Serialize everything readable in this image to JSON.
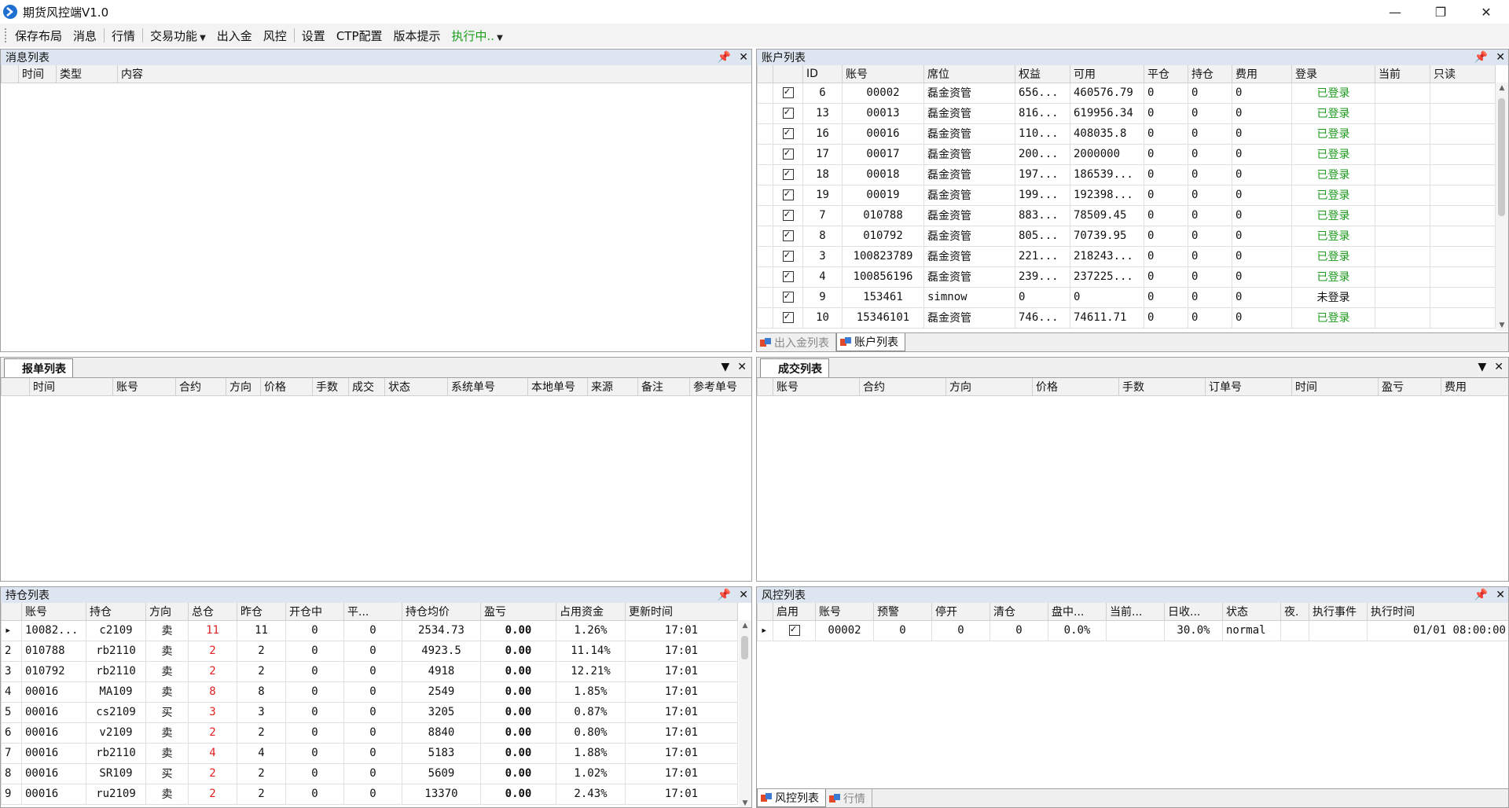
{
  "window": {
    "title": "期货风控端V1.0",
    "minimize": "—",
    "restore": "❐",
    "close": "✕"
  },
  "menu": {
    "items": [
      "保存布局",
      "消息",
      "行情",
      "交易功能",
      "出入金",
      "风控",
      "设置",
      "CTP配置",
      "版本提示",
      "执行中.."
    ]
  },
  "panels": {
    "messages": {
      "title": "消息列表",
      "columns": [
        "时间",
        "类型",
        "内容"
      ]
    },
    "accounts": {
      "title": "账户列表",
      "columns": [
        "",
        "ID",
        "账号",
        "席位",
        "权益",
        "可用",
        "平仓",
        "持仓",
        "费用",
        "登录",
        "当前",
        "只读"
      ],
      "rows": [
        [
          "6",
          "00002",
          "磊金资管",
          "656...",
          "460576.79",
          "0",
          "0",
          "0",
          "已登录"
        ],
        [
          "13",
          "00013",
          "磊金资管",
          "816...",
          "619956.34",
          "0",
          "0",
          "0",
          "已登录"
        ],
        [
          "16",
          "00016",
          "磊金资管",
          "110...",
          "408035.8",
          "0",
          "0",
          "0",
          "已登录"
        ],
        [
          "17",
          "00017",
          "磊金资管",
          "200...",
          "2000000",
          "0",
          "0",
          "0",
          "已登录"
        ],
        [
          "18",
          "00018",
          "磊金资管",
          "197...",
          "186539...",
          "0",
          "0",
          "0",
          "已登录"
        ],
        [
          "19",
          "00019",
          "磊金资管",
          "199...",
          "192398...",
          "0",
          "0",
          "0",
          "已登录"
        ],
        [
          "7",
          "010788",
          "磊金资管",
          "883...",
          "78509.45",
          "0",
          "0",
          "0",
          "已登录"
        ],
        [
          "8",
          "010792",
          "磊金资管",
          "805...",
          "70739.95",
          "0",
          "0",
          "0",
          "已登录"
        ],
        [
          "3",
          "100823789",
          "磊金资管",
          "221...",
          "218243...",
          "0",
          "0",
          "0",
          "已登录"
        ],
        [
          "4",
          "100856196",
          "磊金资管",
          "239...",
          "237225...",
          "0",
          "0",
          "0",
          "已登录"
        ],
        [
          "9",
          "153461",
          "simnow",
          "0",
          "0",
          "0",
          "0",
          "0",
          "未登录"
        ],
        [
          "10",
          "15346101",
          "磊金资管",
          "746...",
          "74611.71",
          "0",
          "0",
          "0",
          "已登录"
        ]
      ],
      "tabs": [
        "出入金列表",
        "账户列表"
      ]
    },
    "orders": {
      "tab": "报单列表",
      "columns": [
        "时间",
        "账号",
        "合约",
        "方向",
        "价格",
        "手数",
        "成交",
        "状态",
        "系统单号",
        "本地单号",
        "来源",
        "备注",
        "参考单号"
      ]
    },
    "trades": {
      "tab": "成交列表",
      "columns": [
        "账号",
        "合约",
        "方向",
        "价格",
        "手数",
        "订单号",
        "时间",
        "盈亏",
        "费用"
      ]
    },
    "positions": {
      "title": "持仓列表",
      "columns": [
        "",
        "账号",
        "持仓",
        "方向",
        "总仓",
        "昨仓",
        "开仓中",
        "平...",
        "持仓均价",
        "盈亏",
        "占用资金",
        "更新时间"
      ],
      "rows": [
        [
          "",
          "10082...",
          "c2109",
          "卖",
          "11",
          "11",
          "0",
          "0",
          "2534.73",
          "0.00",
          "1.26%",
          "17:01"
        ],
        [
          "2",
          "010788",
          "rb2110",
          "卖",
          "2",
          "2",
          "0",
          "0",
          "4923.5",
          "0.00",
          "11.14%",
          "17:01"
        ],
        [
          "3",
          "010792",
          "rb2110",
          "卖",
          "2",
          "2",
          "0",
          "0",
          "4918",
          "0.00",
          "12.21%",
          "17:01"
        ],
        [
          "4",
          "00016",
          "MA109",
          "卖",
          "8",
          "8",
          "0",
          "0",
          "2549",
          "0.00",
          "1.85%",
          "17:01"
        ],
        [
          "5",
          "00016",
          "cs2109",
          "买",
          "3",
          "3",
          "0",
          "0",
          "3205",
          "0.00",
          "0.87%",
          "17:01"
        ],
        [
          "6",
          "00016",
          "v2109",
          "卖",
          "2",
          "2",
          "0",
          "0",
          "8840",
          "0.00",
          "0.80%",
          "17:01"
        ],
        [
          "7",
          "00016",
          "rb2110",
          "卖",
          "4",
          "4",
          "0",
          "0",
          "5183",
          "0.00",
          "1.88%",
          "17:01"
        ],
        [
          "8",
          "00016",
          "SR109",
          "买",
          "2",
          "2",
          "0",
          "0",
          "5609",
          "0.00",
          "1.02%",
          "17:01"
        ],
        [
          "9",
          "00016",
          "ru2109",
          "卖",
          "2",
          "2",
          "0",
          "0",
          "13370",
          "0.00",
          "2.43%",
          "17:01"
        ]
      ]
    },
    "risk": {
      "title": "风控列表",
      "columns": [
        "",
        "启用",
        "账号",
        "预警",
        "停开",
        "清仓",
        "盘中...",
        "当前...",
        "日收...",
        "状态",
        "夜.",
        "执行事件",
        "执行时间"
      ],
      "rows": [
        [
          "",
          "",
          "00002",
          "0",
          "0",
          "0",
          "0.0%",
          "",
          "30.0%",
          "normal",
          "",
          "",
          "01/01 08:00:00"
        ]
      ],
      "tabs": [
        "风控列表",
        "行情"
      ]
    }
  },
  "colors": {
    "accent_green": "#1b9a1b",
    "accent_red": "#e02020",
    "panel_header": "#dde6f0"
  }
}
